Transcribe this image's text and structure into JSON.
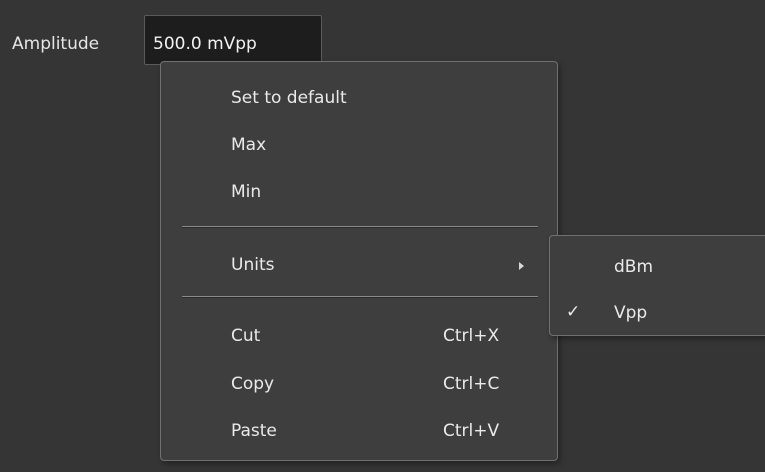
{
  "amplitude": {
    "label": "Amplitude",
    "value": "500.0 mVpp"
  },
  "context_menu": {
    "items": [
      {
        "label": "Set to default"
      },
      {
        "label": "Max"
      },
      {
        "label": "Min"
      },
      {
        "label": "Units",
        "has_submenu": true
      },
      {
        "label": "Cut",
        "shortcut": "Ctrl+X"
      },
      {
        "label": "Copy",
        "shortcut": "Ctrl+C"
      },
      {
        "label": "Paste",
        "shortcut": "Ctrl+V"
      }
    ]
  },
  "units_submenu": {
    "items": [
      {
        "label": "dBm",
        "checked": false
      },
      {
        "label": "Vpp",
        "checked": true,
        "check_mark": "✓"
      }
    ]
  },
  "colors": {
    "background": "#353535",
    "menu_background": "#3e3e3e",
    "field_background": "#1d1d1d",
    "text": "#eaeaea"
  }
}
